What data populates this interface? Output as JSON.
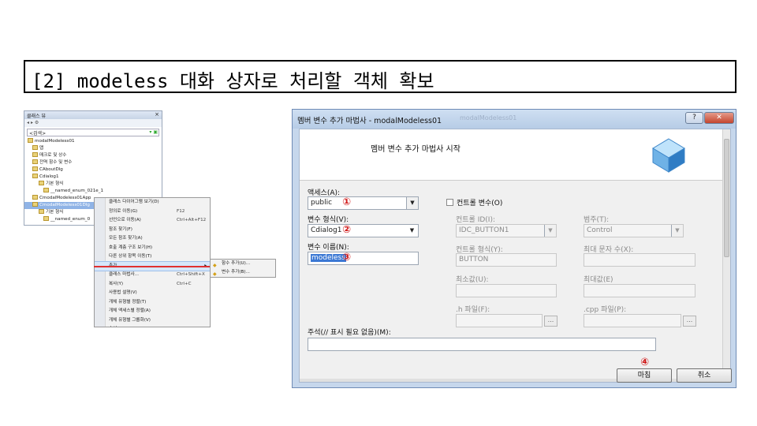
{
  "slide": {
    "title": "[2] modeless 대화 상자로 처리할 객체 확보"
  },
  "class_view": {
    "title": "클래스 뷰",
    "search_placeholder": "<검색>",
    "tree": [
      {
        "label": "modalModeless01"
      },
      {
        "label": "맵"
      },
      {
        "label": "매크로 및 상수"
      },
      {
        "label": "전역 함수 및 변수"
      },
      {
        "label": "CAboutDlg"
      },
      {
        "label": "Cdialog1"
      },
      {
        "label": "기본 형식"
      },
      {
        "label": "__named_enum_021e_1"
      },
      {
        "label": "CmodalModeless01App"
      },
      {
        "label": "CmodalModeless01Dlg",
        "selected": true
      },
      {
        "label": "기본 형식"
      },
      {
        "label": "__named_enum_0"
      }
    ]
  },
  "context_menu": {
    "items": [
      {
        "label": "클래스 다이어그램 보기(D)",
        "shortcut": ""
      },
      {
        "label": "정의로 이동(G)",
        "shortcut": "F12"
      },
      {
        "label": "선언으로 이동(A)",
        "shortcut": "Ctrl+Alt+F12"
      },
      {
        "label": "참조 찾기(F)",
        "shortcut": ""
      },
      {
        "label": "모든 참조 찾기(A)",
        "shortcut": ""
      },
      {
        "label": "호출 계층 구조 보기(H)",
        "shortcut": ""
      },
      {
        "label": "다른 상위 항목 이동(T)",
        "shortcut": ""
      },
      {
        "label": "추가",
        "shortcut": "",
        "highlight": true,
        "submenu": true
      },
      {
        "label": "클래스 마법사...",
        "shortcut": "Ctrl+Shift+X"
      },
      {
        "label": "복사(Y)",
        "shortcut": "Ctrl+C"
      },
      {
        "label": "사용법 설명(V)",
        "shortcut": ""
      },
      {
        "label": "개체 유형별 정렬(T)",
        "shortcut": ""
      },
      {
        "label": "개체 액세스별 정렬(A)",
        "shortcut": ""
      },
      {
        "label": "개체 유형별 그룹화(V)",
        "shortcut": ""
      },
      {
        "label": "속성(R)",
        "shortcut": ""
      }
    ]
  },
  "submenu": {
    "items": [
      {
        "label": "함수 추가(U)..."
      },
      {
        "label": "변수 추가(B)..."
      }
    ]
  },
  "dialog": {
    "title": "멤버 변수 추가 마법사 - modalModeless01",
    "ghost_title": "modalModeless01",
    "help_label": "?",
    "close_label": "✕",
    "banner": "멤버 변수 추가 마법사 시작",
    "access_label": "액세스(A):",
    "access_value": "public",
    "control_var_label": "컨트롤 변수(O)",
    "var_type_label": "변수 형식(V):",
    "var_type_value": "Cdialog1",
    "var_name_label": "변수 이름(N):",
    "var_name_value": "modeless",
    "control_id_label": "컨트롤 ID(I):",
    "control_id_value": "IDC_BUTTON1",
    "category_label": "범주(T):",
    "category_value": "Control",
    "control_type_label": "컨트롤 형식(Y):",
    "control_type_value": "BUTTON",
    "max_chars_label": "최대 문자 수(X):",
    "min_value_label": "최소값(U):",
    "max_value_label": "최대값(E)",
    "h_file_label": ".h 파일(F):",
    "cpp_file_label": ".cpp 파일(P):",
    "browse_label": "...",
    "comment_label": "주석(// 표시 필요 없음)(M):",
    "finish_label": "마침",
    "cancel_label": "취소"
  },
  "markers": {
    "m1": "①",
    "m2": "②",
    "m3": "③",
    "m4": "④"
  },
  "colors": {
    "marker": "#d01818",
    "highlight_line": "#e03030",
    "selection": "#3b78d4"
  }
}
